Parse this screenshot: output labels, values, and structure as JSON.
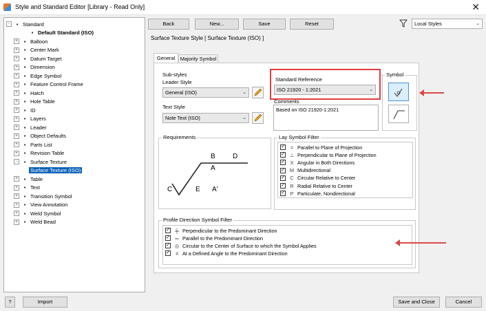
{
  "window": {
    "title": "Style and Standard Editor [Library - Read Only]"
  },
  "tree": {
    "items": [
      {
        "label": "Standard",
        "icon": "standard-icon",
        "expander": "-"
      },
      {
        "label": "Default Standard (ISO)",
        "icon": "standard-doc-icon",
        "expander": ""
      },
      {
        "label": "Balloon",
        "icon": "balloon-icon",
        "expander": "+"
      },
      {
        "label": "Center Mark",
        "icon": "center-mark-icon",
        "expander": "+"
      },
      {
        "label": "Datum Target",
        "icon": "datum-target-icon",
        "expander": "+"
      },
      {
        "label": "Dimension",
        "icon": "dimension-icon",
        "expander": "+"
      },
      {
        "label": "Edge Symbol",
        "icon": "edge-symbol-icon",
        "expander": "+"
      },
      {
        "label": "Feature Control Frame",
        "icon": "fcf-icon",
        "expander": "+"
      },
      {
        "label": "Hatch",
        "icon": "hatch-icon",
        "expander": "+"
      },
      {
        "label": "Hole Table",
        "icon": "hole-table-icon",
        "expander": "+"
      },
      {
        "label": "ID",
        "icon": "id-icon",
        "expander": "+"
      },
      {
        "label": "Layers",
        "icon": "layers-icon",
        "expander": "+"
      },
      {
        "label": "Leader",
        "icon": "leader-icon",
        "expander": "+"
      },
      {
        "label": "Object Defaults",
        "icon": "object-defaults-icon",
        "expander": "+"
      },
      {
        "label": "Parts List",
        "icon": "parts-list-icon",
        "expander": "+"
      },
      {
        "label": "Revision Table",
        "icon": "revision-table-icon",
        "expander": "+"
      },
      {
        "label": "Surface Texture",
        "icon": "surface-texture-icon",
        "expander": "-"
      },
      {
        "label": "Surface Texture (ISO)",
        "icon": "",
        "expander": ""
      },
      {
        "label": "Table",
        "icon": "table-icon",
        "expander": "+"
      },
      {
        "label": "Text",
        "icon": "text-icon",
        "expander": "+"
      },
      {
        "label": "Transition Symbol",
        "icon": "transition-icon",
        "expander": "+"
      },
      {
        "label": "View Annotation",
        "icon": "view-annotation-icon",
        "expander": "+"
      },
      {
        "label": "Weld Symbol",
        "icon": "weld-symbol-icon",
        "expander": "+"
      },
      {
        "label": "Weld Bead",
        "icon": "weld-bead-icon",
        "expander": "+"
      }
    ]
  },
  "toolbar": {
    "back": "Back",
    "new": "New...",
    "save": "Save",
    "reset": "Reset",
    "filter_value": "Local Styles"
  },
  "style_heading": "Surface Texture Style [ Surface Texture (ISO) ]",
  "tabs": {
    "general": "General",
    "majority": "Majority Symbol"
  },
  "substyles": {
    "title": "Sub-styles",
    "leader_label": "Leader Style",
    "leader_value": "General (ISO)",
    "text_label": "Text Style",
    "text_value": "Note Text (ISO)"
  },
  "standard_ref": {
    "label": "Standard Reference",
    "value": "ISO 21920 - 1:2021",
    "comments_label": "Comments",
    "comments_value": "Based on ISO 21920-1:2021"
  },
  "symbol": {
    "label": "Symbol"
  },
  "requirements": {
    "label": "Requirements",
    "b": "B",
    "d": "D",
    "a": "A",
    "c": "C",
    "e": "E",
    "a_prime": "A'"
  },
  "lay_filter": {
    "label": "Lay Symbol Filter",
    "items": [
      {
        "sym": "=",
        "text": "Parallel to Plane of Projection"
      },
      {
        "sym": "⊥",
        "text": "Perpendicular to Plane of Projection"
      },
      {
        "sym": "X",
        "text": "Angular in Both Directions"
      },
      {
        "sym": "M",
        "text": "Multidirectional"
      },
      {
        "sym": "C",
        "text": "Circular Relative to Center"
      },
      {
        "sym": "R",
        "text": "Radial Relative to Center"
      },
      {
        "sym": "P",
        "text": "Particulate, Nondirectional"
      }
    ]
  },
  "profile_filter": {
    "label": "Profile Direction Symbol Filter",
    "items": [
      {
        "sym": "╪",
        "text": "Perpendicular to the Predominant Direction"
      },
      {
        "sym": "═",
        "text": "Parallel to the Predominant Direction"
      },
      {
        "sym": "◎",
        "text": "Circular to the Center of Surface to which the Symbol Applies"
      },
      {
        "sym": "≠",
        "text": "At a Defined Angle to the Predominant Direction"
      }
    ]
  },
  "footer": {
    "help": "?",
    "import": "Import",
    "save_close": "Save and Close",
    "cancel": "Cancel"
  },
  "colors": {
    "highlight": "#e03c3c",
    "selection": "#0b62b8"
  }
}
